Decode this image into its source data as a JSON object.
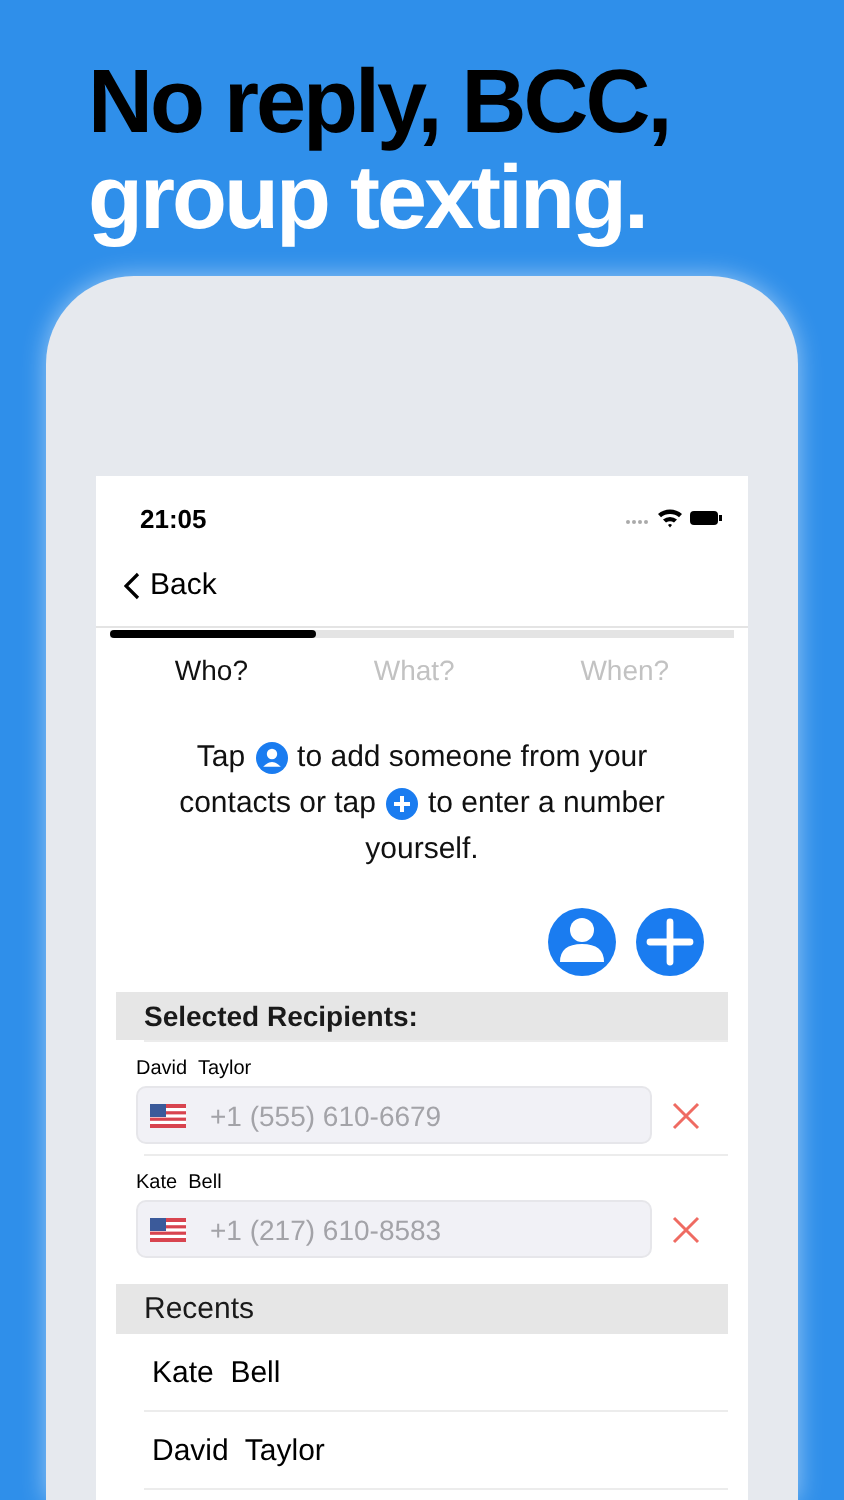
{
  "headline": {
    "line_1": "No reply, BCC,",
    "line_2": "group texting."
  },
  "status_bar": {
    "time": "21:05"
  },
  "nav": {
    "back": "Back"
  },
  "progress": {
    "level": 0.33
  },
  "steps": [
    {
      "label": "Who?",
      "selected": true
    },
    {
      "label": "What?",
      "selected": false
    },
    {
      "label": "When?",
      "selected": false
    }
  ],
  "instructions": [
    [
      {
        "kind": "text",
        "text": "Tap"
      },
      {
        "kind": "contact"
      },
      {
        "kind": "text",
        "text": "to add someone from your"
      }
    ],
    [
      {
        "kind": "text",
        "text": "contacts or tap"
      },
      {
        "kind": "add"
      },
      {
        "kind": "text",
        "text": "to enter a number"
      }
    ],
    [
      {
        "kind": "text",
        "text": "yourself."
      }
    ]
  ],
  "selected_header": "Selected Recipients:",
  "recipients": [
    {
      "name": "David  Taylor",
      "placeholder": "+1 (555) 610-6679"
    },
    {
      "name": "Kate  Bell",
      "placeholder": "+1 (217) 610-8583"
    }
  ],
  "recents_header": "Recents",
  "recents": [
    "Kate  Bell",
    "David  Taylor"
  ]
}
